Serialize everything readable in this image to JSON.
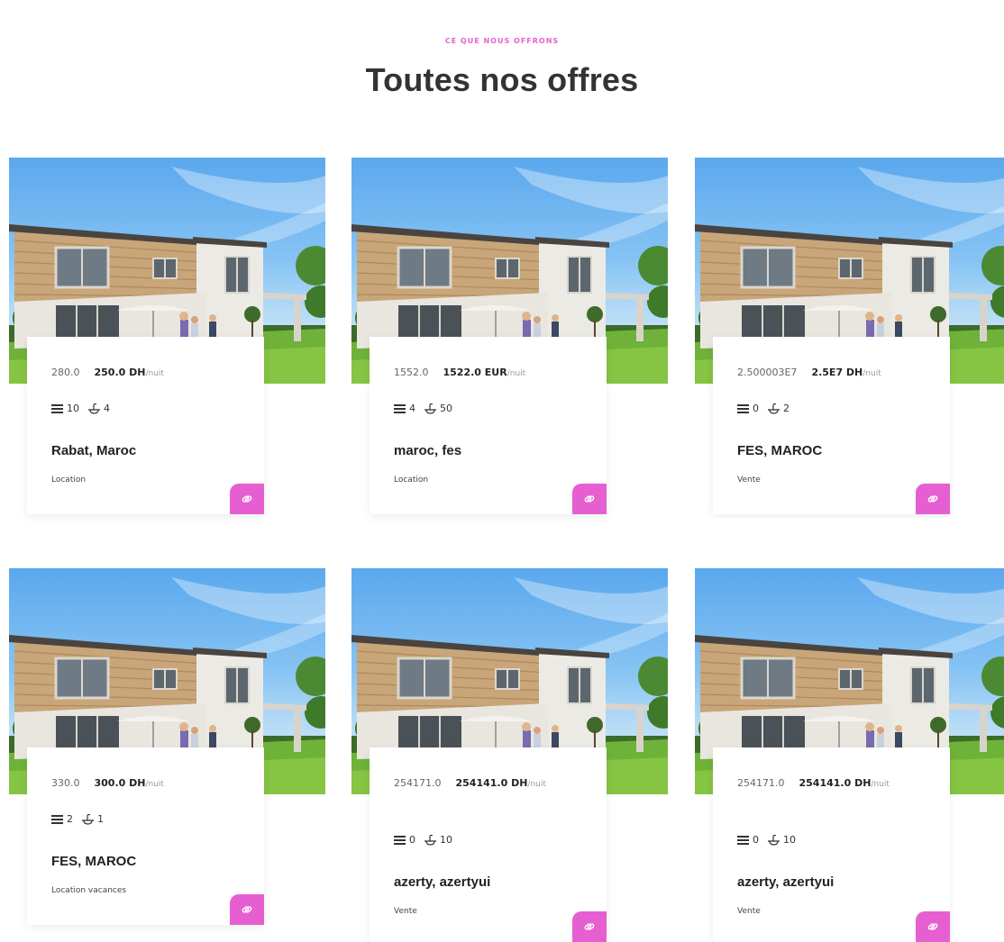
{
  "section": {
    "eyebrow": "CE QUE NOUS OFFRONS",
    "title": "Toutes nos offres"
  },
  "colors": {
    "accent": "#e65fd0"
  },
  "icons": {
    "rooms": "bed-icon",
    "baths": "bath-icon",
    "link": "link-icon"
  },
  "offers": [
    {
      "old_price": "280.0",
      "new_price": "250.0 DH",
      "unit": "/nuit",
      "rooms": "10",
      "baths": "4",
      "city": "Rabat, Maroc",
      "type": "Location"
    },
    {
      "old_price": "1552.0",
      "new_price": "1522.0 EUR",
      "unit": "/nuit",
      "rooms": "4",
      "baths": "50",
      "city": "maroc, fes",
      "type": "Location"
    },
    {
      "old_price": "2.500003E7",
      "new_price": "2.5E7 DH",
      "unit": "/nuit",
      "rooms": "0",
      "baths": "2",
      "city": "FES, MAROC",
      "type": "Vente"
    },
    {
      "old_price": "330.0",
      "new_price": "300.0 DH",
      "unit": "/nuit",
      "rooms": "2",
      "baths": "1",
      "city": "FES, MAROC",
      "type": "Location vacances"
    },
    {
      "old_price": "254171.0",
      "new_price": "254141.0 DH",
      "unit": "/nuit",
      "rooms": "0",
      "baths": "10",
      "city": "azerty, azertyui",
      "type": "Vente"
    },
    {
      "old_price": "254171.0",
      "new_price": "254141.0 DH",
      "unit": "/nuit",
      "rooms": "0",
      "baths": "10",
      "city": "azerty, azertyui",
      "type": "Vente"
    }
  ]
}
